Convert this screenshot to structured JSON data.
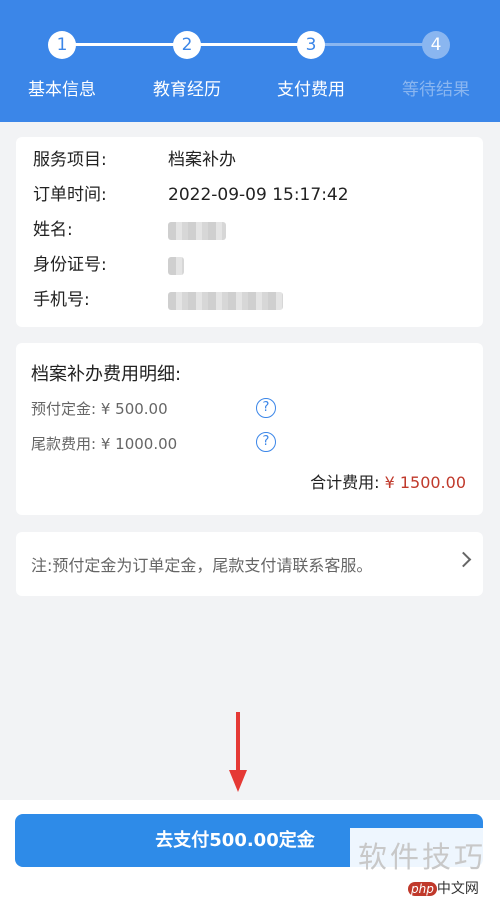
{
  "steps": [
    {
      "number": "1",
      "label": "基本信息",
      "active": true
    },
    {
      "number": "2",
      "label": "教育经历",
      "active": true
    },
    {
      "number": "3",
      "label": "支付费用",
      "active": true
    },
    {
      "number": "4",
      "label": "等待结果",
      "active": false
    }
  ],
  "order_info": {
    "service_label": "服务项目:",
    "service_value": "档案补办",
    "time_label": "订单时间:",
    "time_value": "2022-09-09 15:17:42",
    "name_label": "姓名:",
    "id_label": "身份证号:",
    "phone_label": "手机号:"
  },
  "fees": {
    "title": "档案补办费用明细:",
    "deposit_label": "预付定金:",
    "deposit_value": "¥ 500.00",
    "balance_label": "尾款费用:",
    "balance_value": "¥ 1000.00",
    "help_glyph": "?",
    "total_label": "合计费用:",
    "total_value": "¥ 1500.00"
  },
  "note": {
    "text": "注:预付定金为订单定金，尾款支付请联系客服。"
  },
  "pay_button": {
    "label": "去支付500.00定金"
  },
  "watermark": {
    "text": "软件技巧",
    "logo_php": "php",
    "logo_site": "中文网"
  },
  "colors": {
    "header": "#3b86e8",
    "button": "#2e8be8",
    "total_amount": "#c0392b",
    "arrow": "#e53935"
  }
}
